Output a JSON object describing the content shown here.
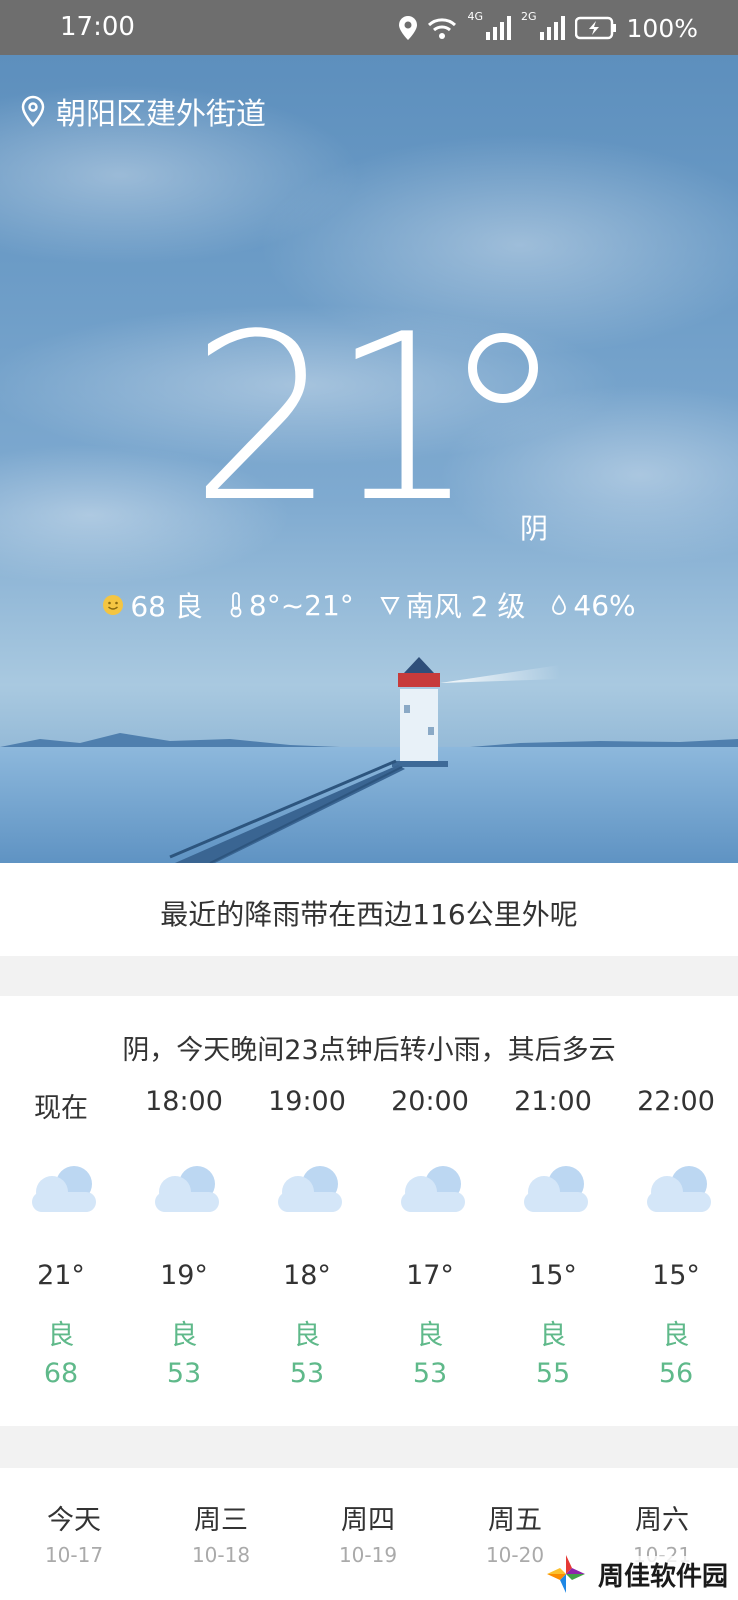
{
  "status_bar": {
    "time": "17:00",
    "battery": "100%",
    "network1": "4G",
    "network2": "2G"
  },
  "location": "朝阳区建外街道",
  "current": {
    "temperature": "21",
    "condition": "阴",
    "aqi": "68 良",
    "temp_range": "8°~21°",
    "wind": "南风 2 级",
    "humidity": "46%"
  },
  "rain_note": "最近的降雨带在西边116公里外呢",
  "hourly": {
    "summary": "阴，今天晚间23点钟后转小雨，其后多云",
    "items": [
      {
        "time": "现在",
        "temp": "21°",
        "aqi_label": "良",
        "aqi": "68",
        "icon": "cloudy-icon"
      },
      {
        "time": "18:00",
        "temp": "19°",
        "aqi_label": "良",
        "aqi": "53",
        "icon": "cloudy-icon"
      },
      {
        "time": "19:00",
        "temp": "18°",
        "aqi_label": "良",
        "aqi": "53",
        "icon": "cloudy-icon"
      },
      {
        "time": "20:00",
        "temp": "17°",
        "aqi_label": "良",
        "aqi": "53",
        "icon": "cloudy-icon"
      },
      {
        "time": "21:00",
        "temp": "15°",
        "aqi_label": "良",
        "aqi": "55",
        "icon": "cloudy-icon"
      },
      {
        "time": "22:00",
        "temp": "15°",
        "aqi_label": "良",
        "aqi": "56",
        "icon": "cloudy-icon"
      }
    ]
  },
  "daily": [
    {
      "day": "今天",
      "date": "10-17"
    },
    {
      "day": "周三",
      "date": "10-18"
    },
    {
      "day": "周四",
      "date": "10-19"
    },
    {
      "day": "周五",
      "date": "10-20"
    },
    {
      "day": "周六",
      "date": "10-21"
    }
  ],
  "watermark": "周佳软件园",
  "colors": {
    "aqi_good": "#5fb98a",
    "status_bar": "#6e6e6e",
    "sky": "#6b9bc6"
  }
}
